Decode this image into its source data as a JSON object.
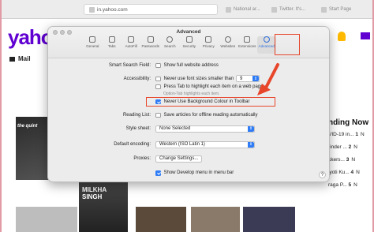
{
  "browser": {
    "url": "in.yahoo.com",
    "tabs": [
      "National ar...",
      "Twitter. It's...",
      "Start Page"
    ]
  },
  "yahoo": {
    "logo": "yaho",
    "mail_label": "Mail",
    "tile1_caption": "the quint",
    "tile2_caption_line1": "MILKHA",
    "tile2_caption_line2": "SINGH",
    "trending_title": "nding Now",
    "trending": [
      {
        "num": "1",
        "label": "VID-19 in..."
      },
      {
        "num": "2",
        "label": "rinder ..."
      },
      {
        "num": "3",
        "label": "ckers..."
      },
      {
        "num": "4",
        "label": "jyoti Ku..."
      },
      {
        "num": "5",
        "label": "raga P..."
      }
    ],
    "trending_right": [
      "N",
      "N",
      "N",
      "N",
      "N"
    ]
  },
  "prefs": {
    "title": "Advanced",
    "tabs": [
      {
        "label": "General",
        "icon": "switch-icon"
      },
      {
        "label": "Tabs",
        "icon": "tabs-icon"
      },
      {
        "label": "AutoFill",
        "icon": "pencil-icon"
      },
      {
        "label": "Passwords",
        "icon": "key-icon"
      },
      {
        "label": "Search",
        "icon": "magnifier-icon"
      },
      {
        "label": "Security",
        "icon": "lock-icon"
      },
      {
        "label": "Privacy",
        "icon": "hand-icon"
      },
      {
        "label": "Websites",
        "icon": "globe-icon"
      },
      {
        "label": "Extensions",
        "icon": "puzzle-icon"
      },
      {
        "label": "Advanced",
        "icon": "gears-icon"
      }
    ],
    "smart_search_label": "Smart Search Field:",
    "show_full_address": "Show full website address",
    "accessibility_label": "Accessibility:",
    "never_font_sizes": "Never use font sizes smaller than",
    "font_size_value": "9",
    "press_tab": "Press Tab to highlight each item on a web page",
    "option_tab_hint": "Option-Tab highlights each item.",
    "never_bg_colour": "Never Use Background Colour in Toolbar",
    "reading_list_label": "Reading List:",
    "save_articles": "Save articles for offline reading automatically",
    "style_sheet_label": "Style sheet:",
    "style_sheet_value": "None Selected",
    "encoding_label": "Default encoding:",
    "encoding_value": "Western (ISO Latin 1)",
    "proxies_label": "Proxies:",
    "change_settings": "Change Settings...",
    "show_develop": "Show Develop menu in menu bar",
    "help": "?"
  },
  "colors": {
    "accent_blue": "#2f7cf6",
    "annotation_red": "#e7462b",
    "yahoo_purple": "#6001d2"
  }
}
